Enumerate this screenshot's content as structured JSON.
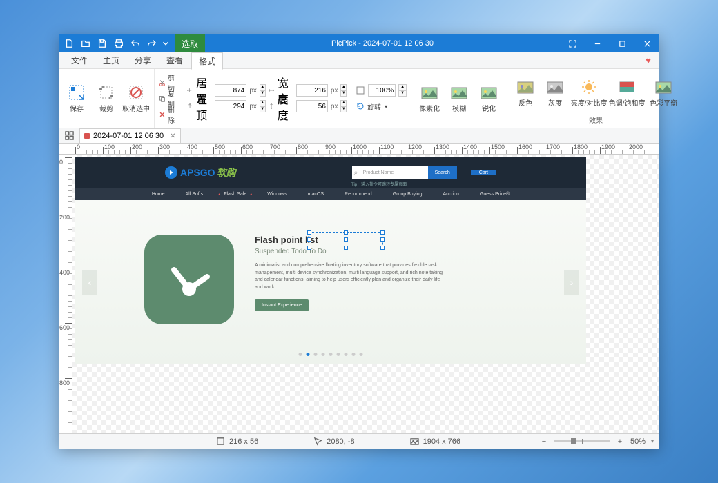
{
  "titlebar": {
    "selection_label": "选取",
    "title": "PicPick - 2024-07-01 12 06 30"
  },
  "menu": {
    "file": "文件",
    "home": "主页",
    "share": "分享",
    "view": "查看",
    "format": "格式"
  },
  "ribbon": {
    "save": "保存",
    "crop": "裁剪",
    "deselect": "取消选中",
    "cut": "剪切",
    "copy": "复制",
    "delete": "删除",
    "left": "居左",
    "top": "置顶",
    "width": "宽度",
    "height": "高度",
    "left_val": "874",
    "top_val": "294",
    "width_val": "216",
    "height_val": "56",
    "unit": "px",
    "zoom_val": "100%",
    "rotate": "旋转",
    "pixelate": "像素化",
    "blur": "模糊",
    "sharpen": "锐化",
    "invert": "反色",
    "grayscale": "灰度",
    "brightness": "亮度/对比度",
    "hue": "色调/饱和度",
    "colorbalance": "色彩平衡",
    "effects": "效果"
  },
  "tab": {
    "name": "2024-07-01 12 06 30"
  },
  "ruler": [
    "0",
    "100",
    "200",
    "300",
    "400",
    "500",
    "600",
    "700",
    "800",
    "900",
    "1000",
    "1100",
    "1200",
    "1300",
    "1400",
    "1500",
    "1600",
    "1700",
    "1800",
    "1900",
    "2000"
  ],
  "ruler_v": [
    "0",
    "200",
    "400",
    "600",
    "800"
  ],
  "webpage": {
    "logo1": "APSGO",
    "logo2": "软购",
    "search_placeholder": "Product Name",
    "search_btn": "Search",
    "cart": "Cart",
    "tip": "Tip：输入指令可跳转专属页面",
    "nav": [
      "Home",
      "All Softs",
      "Flash Sale",
      "Windows",
      "macOS",
      "Recommend",
      "Group Buying",
      "Auction",
      "Guess Price®"
    ],
    "hero_title": "Flash point list",
    "hero_sub": "Suspended Todo To Do",
    "hero_desc": "A minimalist and comprehensive floating inventory software that provides flexible task management, multi device synchronization, multi language support, and rich note taking and calendar functions, aiming to help users efficiently plan and organize their daily life and work.",
    "hero_btn": "Instant Experience"
  },
  "status": {
    "size": "216 x 56",
    "pos": "2080, -8",
    "canvas": "1904 x 766",
    "zoom": "50%"
  }
}
